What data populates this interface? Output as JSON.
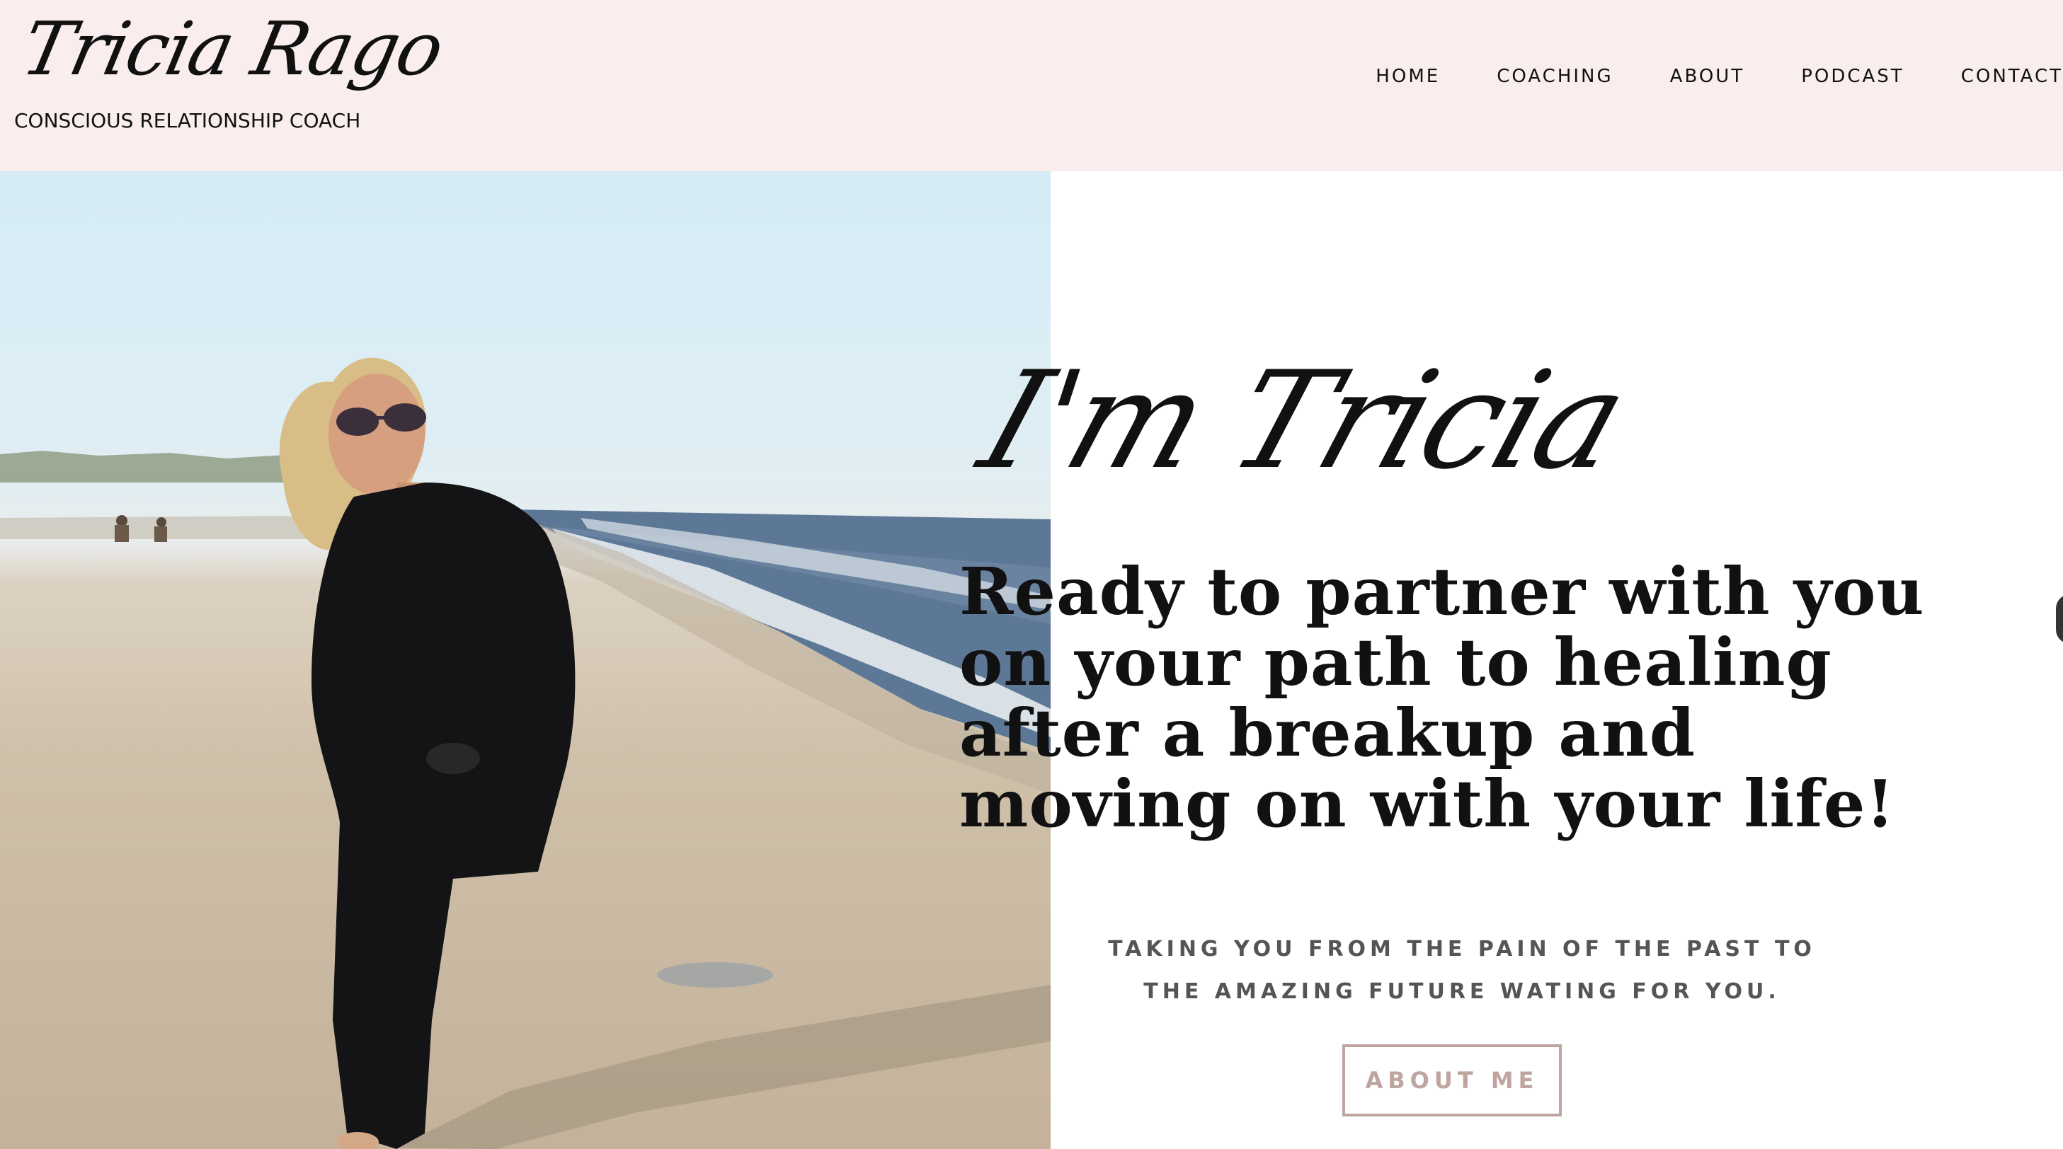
{
  "header": {
    "logo_script": "Tricia Rago",
    "tagline": "CONSCIOUS RELATIONSHIP COACH",
    "nav": [
      "HOME",
      "COACHING",
      "ABOUT",
      "PODCAST",
      "CONTACT"
    ],
    "background_color": "#f9eeed"
  },
  "hero": {
    "script_title": "I'm Tricia",
    "headline_lines": [
      "Ready to partner with you",
      "on your path to healing",
      "after a breakup and",
      "moving on with your life!"
    ],
    "subheading_lines": [
      "TAKING YOU FROM THE PAIN OF THE PAST TO",
      "THE AMAZING FUTURE WATING FOR YOU."
    ],
    "button_label": "ABOUT ME",
    "button_color": "#bfa59f"
  }
}
